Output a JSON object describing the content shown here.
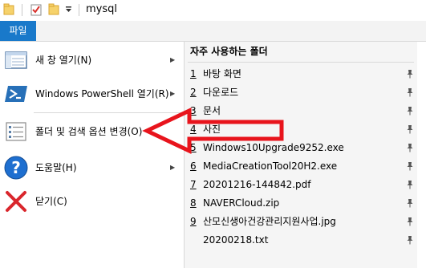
{
  "window": {
    "title": "mysql",
    "quick_access_icons": [
      "folder-icon",
      "properties-checkmark-icon",
      "new-folder-icon",
      "customize-dropdown-icon"
    ]
  },
  "ribbon": {
    "file_tab_label": "파일",
    "accent_color": "#1979ca"
  },
  "file_menu": {
    "items": [
      {
        "label": "새 창 열기(N)",
        "icon": "new-window-icon",
        "has_submenu": true
      },
      {
        "label": "Windows PowerShell 열기(R)",
        "icon": "powershell-icon",
        "has_submenu": true
      },
      {
        "label": "폴더 및 검색 옵션 변경(O)",
        "icon": "folder-options-icon",
        "has_submenu": false
      },
      {
        "label": "도움말(H)",
        "icon": "help-icon",
        "has_submenu": true
      },
      {
        "label": "닫기(C)",
        "icon": "close-icon",
        "has_submenu": false
      }
    ],
    "submenu_arrow": "▶"
  },
  "frequent_folders": {
    "header": "자주 사용하는 폴더",
    "items": [
      {
        "num": "1",
        "name": "바탕 화면"
      },
      {
        "num": "2",
        "name": "다운로드"
      },
      {
        "num": "3",
        "name": "문서"
      },
      {
        "num": "4",
        "name": "사진"
      },
      {
        "num": "5",
        "name": "Windows10Upgrade9252.exe"
      },
      {
        "num": "6",
        "name": "MediaCreationTool20H2.exe"
      },
      {
        "num": "7",
        "name": "20201216-144842.pdf"
      },
      {
        "num": "8",
        "name": "NAVERCloud.zip"
      },
      {
        "num": "9",
        "name": "산모신생아건강관리지원사업.jpg"
      },
      {
        "num": "",
        "name": "20200218.txt"
      }
    ]
  },
  "annotation": {
    "arrow_color": "#e8141c",
    "points_to": "폴더 및 검색 옵션 변경(O)"
  }
}
